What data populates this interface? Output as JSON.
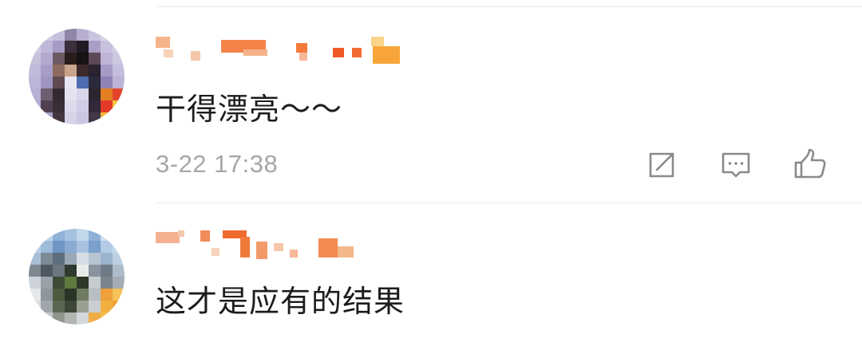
{
  "comments": [
    {
      "text": "干得漂亮～～",
      "time": "3-22 17:38",
      "actions": {
        "share_icon": "share-icon",
        "reply_icon": "comment-icon",
        "like_icon": "thumbs-up-icon"
      }
    },
    {
      "text": "这才是应有的结果"
    }
  ],
  "colors": {
    "text": "#1c1c1c",
    "meta": "#a6a6a6",
    "divider": "#ececec",
    "icon": "#8a8a8a",
    "username_blur": "#f07a2e"
  }
}
